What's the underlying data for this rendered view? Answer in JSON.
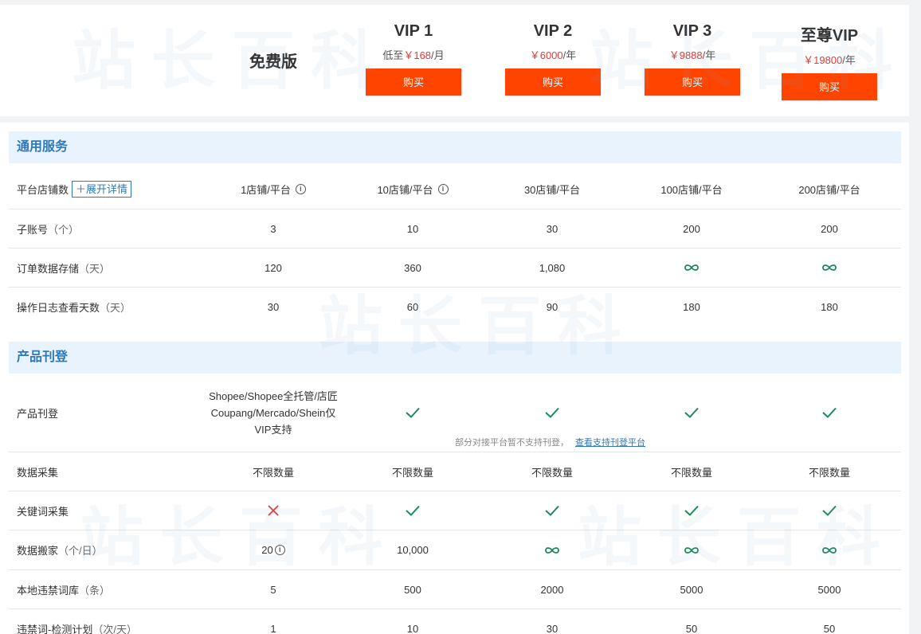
{
  "plans": [
    {
      "name": "免费版",
      "price_prefix": "",
      "price": "",
      "price_suffix": "",
      "buy": ""
    },
    {
      "name": "VIP 1",
      "price_prefix": "低至",
      "price": "￥168",
      "price_suffix": "/月",
      "buy": "购买"
    },
    {
      "name": "VIP 2",
      "price_prefix": "",
      "price": "￥6000",
      "price_suffix": "/年",
      "buy": "购买"
    },
    {
      "name": "VIP 3",
      "price_prefix": "",
      "price": "￥9888",
      "price_suffix": "/年",
      "buy": "购买"
    },
    {
      "name": "至尊VIP",
      "price_prefix": "",
      "price": "￥19800",
      "price_suffix": "/年",
      "buy": "购买"
    }
  ],
  "sections": {
    "general": {
      "title": "通用服务",
      "shop_count": {
        "label": "平台店铺数",
        "expand": "＋展开详情",
        "values": [
          "1店铺/平台",
          "10店铺/平台",
          "30店铺/平台",
          "100店铺/平台",
          "200店铺/平台"
        ]
      },
      "sub_accounts": {
        "label": "子账号",
        "unit": "（个）",
        "values": [
          "3",
          "10",
          "30",
          "200",
          "200"
        ]
      },
      "order_storage": {
        "label": "订单数据存储",
        "unit": "（天）",
        "values": [
          "120",
          "360",
          "1,080"
        ]
      },
      "log_days": {
        "label": "操作日志查看天数",
        "unit": "（天）",
        "values": [
          "30",
          "60",
          "90",
          "180",
          "180"
        ]
      }
    },
    "publish": {
      "title": "产品刊登",
      "product_publish": {
        "label": "产品刊登",
        "free_line1": "Shopee/Shopee全托管/店匠",
        "free_line2": "Coupang/Mercado/Shein仅",
        "free_line3": "VIP支持",
        "note": "部分对接平台暂不支持刊登，",
        "note_link": "查看支持刊登平台"
      },
      "data_collect": {
        "label": "数据采集",
        "values": [
          "不限数量",
          "不限数量",
          "不限数量",
          "不限数量",
          "不限数量"
        ]
      },
      "keyword_collect": {
        "label": "关键词采集"
      },
      "data_move": {
        "label": "数据搬家",
        "unit": "（个/日）",
        "values": [
          "20",
          "10,000"
        ]
      },
      "banned_words": {
        "label": "本地违禁词库",
        "unit": "（条）",
        "values": [
          "5",
          "500",
          "2000",
          "5000",
          "5000"
        ]
      },
      "banned_check": {
        "label": "违禁词-检测计划",
        "unit": "（次/天）",
        "values": [
          "1",
          "10",
          "30",
          "50",
          "50"
        ]
      }
    }
  },
  "watermark": "站长百科",
  "colors": {
    "accent": "#ff4400",
    "price": "#e53935",
    "check": "#1a8a5a",
    "cross": "#e53935",
    "section": "#2f79b8"
  }
}
